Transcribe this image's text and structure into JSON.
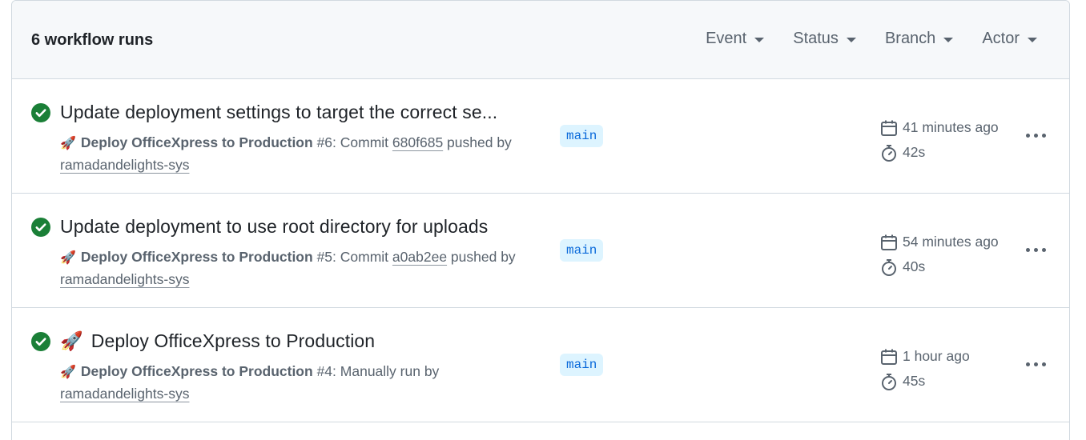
{
  "header": {
    "runs_count": "6 workflow runs",
    "filters": [
      {
        "label": "Event"
      },
      {
        "label": "Status"
      },
      {
        "label": "Branch"
      },
      {
        "label": "Actor"
      }
    ]
  },
  "runs": [
    {
      "title": "Update deployment settings to target the correct se...",
      "title_has_rocket": false,
      "workflow_name": "Deploy OfficeXpress to Production",
      "run_number": "#6",
      "trigger_text": ": Commit ",
      "commit": "680f685",
      "trigger_suffix": " pushed by",
      "actor": "ramadandelights-sys",
      "branch": "main",
      "time_ago": "41 minutes ago",
      "duration": "42s",
      "status": "success"
    },
    {
      "title": "Update deployment to use root directory for uploads",
      "title_has_rocket": false,
      "workflow_name": "Deploy OfficeXpress to Production",
      "run_number": "#5",
      "trigger_text": ": Commit ",
      "commit": "a0ab2ee",
      "trigger_suffix": " pushed by",
      "actor": "ramadandelights-sys",
      "branch": "main",
      "time_ago": "54 minutes ago",
      "duration": "40s",
      "status": "success"
    },
    {
      "title": "Deploy OfficeXpress to Production",
      "title_has_rocket": true,
      "workflow_name": "Deploy OfficeXpress to Production",
      "run_number": "#4",
      "trigger_text": ": Manually run by",
      "commit": "",
      "trigger_suffix": "",
      "actor": "ramadandelights-sys",
      "branch": "main",
      "time_ago": "1 hour ago",
      "duration": "45s",
      "status": "success"
    }
  ],
  "icons": {
    "status": "check-circle-fill-icon",
    "calendar": "calendar-icon",
    "stopwatch": "stopwatch-icon",
    "menu": "kebab-horizontal-icon",
    "workflow": "rocket-emoji"
  },
  "colors": {
    "success": "#1a7f37",
    "branch_bg": "#ddf4ff",
    "branch_fg": "#0969da",
    "muted": "#59636e",
    "border": "#d1d9e0",
    "header_bg": "#f6f8fa"
  }
}
